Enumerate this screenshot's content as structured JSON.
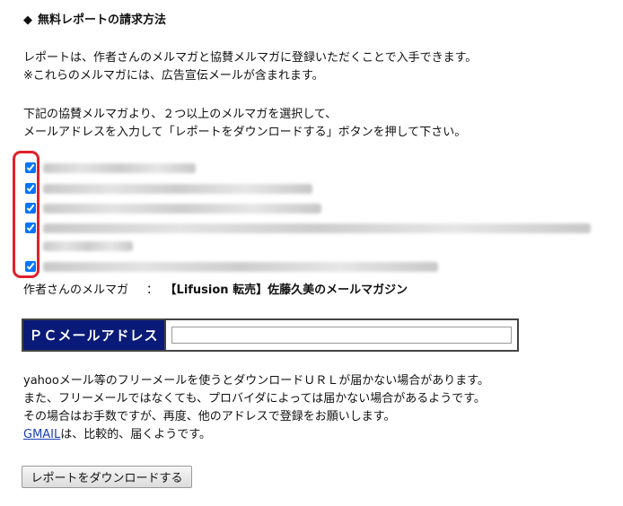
{
  "heading": {
    "bullet": "◆",
    "title": "無料レポートの請求方法"
  },
  "intro": {
    "line1": "レポートは、作者さんのメルマガと協賛メルマガに登録いただくことで入手できます。",
    "line2": "※これらのメルマガには、広告宣伝メールが含まれます。"
  },
  "instruction": {
    "line1": "下記の協賛メルマガより、２つ以上のメルマガを選択して、",
    "line2": "メールアドレスを入力して「レポートをダウンロードする」ボタンを押して下さい。"
  },
  "checklist": [
    {
      "checked": true,
      "label_blurred": true
    },
    {
      "checked": true,
      "label_blurred": true
    },
    {
      "checked": true,
      "label_blurred": true
    },
    {
      "checked": true,
      "label_blurred": true
    },
    {
      "checked": true,
      "label_blurred": true
    }
  ],
  "author": {
    "label": "作者さんのメルマガ",
    "separator": "：",
    "name": "【Lifusion 転売】佐藤久美のメールマガジン"
  },
  "email": {
    "label": "ＰＣメールアドレス",
    "value": "",
    "placeholder": ""
  },
  "notice": {
    "line1": "yahooメール等のフリーメールを使うとダウンロードＵＲＬが届かない場合があります。",
    "line2": "また、フリーメールではなくても、プロバイダによっては届かない場合があるようです。",
    "line3": "その場合はお手数ですが、再度、他のアドレスで登録をお願いします。",
    "gmail_link": "GMAIL",
    "line4_rest": "は、比較的、届くようです。"
  },
  "download_button": "レポートをダウンロードする",
  "colors": {
    "email_label_bg": "#0a1a78",
    "highlight_box": "#e0202a",
    "link": "#1a3fb3"
  }
}
